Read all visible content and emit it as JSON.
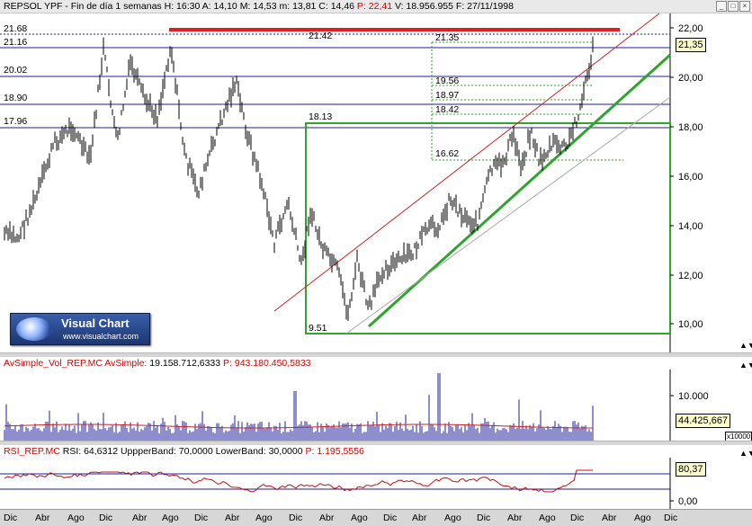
{
  "main_chart": {
    "header": {
      "symbol": "REPSOL YPF",
      "period": "Fin de día 1 semanas",
      "h_label": "H:",
      "h_value": "16:30",
      "a_label": "A:",
      "a_value": "14,10",
      "m_label": "M:",
      "m_value": "14,53",
      "lo_label": "m:",
      "lo_value": "13,81",
      "c_label": "C:",
      "c_value": "14,46",
      "p_label": "P:",
      "p_value": "22,41",
      "v_label": "V:",
      "v_value": "18.956.955",
      "f_label": "F:",
      "f_value": "27/11/1998"
    },
    "left_levels": [
      "21.68",
      "21.16",
      "20.02",
      "18.90",
      "17.96"
    ],
    "annotations": [
      "21.42",
      "21.35",
      "19.56",
      "18.97",
      "18.42",
      "18.13",
      "16.62",
      "9.51"
    ],
    "y_ticks": [
      "22,00",
      "20,00",
      "18,00",
      "16,00",
      "14,00",
      "12,00",
      "10,00"
    ],
    "price_box": "21,35",
    "logo": {
      "title": "Visual Chart",
      "url": "www.visualchart.com"
    }
  },
  "volume_pane": {
    "label_name": "AvSimple_Vol_REP.MC",
    "label_indicator": "AvSimple:",
    "label_value": "19.158.712,6333",
    "label_p": "P: 943.180.450,5833",
    "y_tick": "10.000",
    "value_box": "44.425,667",
    "multiplier": "x10000"
  },
  "rsi_pane": {
    "label_name": "RSI_REP.MC",
    "label_rsi": "RSI: 64,6312",
    "upper_band": "UppperBand: 70,0000",
    "lower_band": "LowerBand: 30,0000",
    "label_p": "P: 1.195,5556",
    "value_box": "80,37",
    "y_tick": "0,00"
  },
  "x_axis": [
    "Dic",
    "Abr",
    "Ago",
    "Dic",
    "Abr",
    "Ago",
    "Dic",
    "Abr",
    "Ago",
    "Dic",
    "Abr",
    "Ago",
    "Dic",
    "Abr",
    "Ago",
    "Dic",
    "Abr",
    "Ago",
    "Dic",
    "Abr",
    "Ago",
    "Dic"
  ],
  "window_buttons": [
    "_",
    "□",
    "×"
  ]
}
